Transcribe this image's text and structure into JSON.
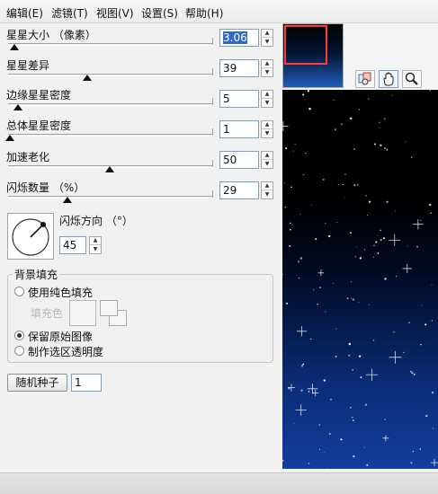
{
  "menu": [
    "编辑(E)",
    "滤镜(T)",
    "视图(V)",
    "设置(S)",
    "帮助(H)"
  ],
  "sliders": [
    {
      "label": "星星大小 （像素）",
      "value": "3.06",
      "selected": true,
      "level": 0.03
    },
    {
      "label": "星星差异",
      "value": "39",
      "selected": false,
      "level": 0.39
    },
    {
      "label": "边缘星星密度",
      "value": "5",
      "selected": false,
      "level": 0.05
    },
    {
      "label": "总体星星密度",
      "value": "1",
      "selected": false,
      "level": 0.01
    },
    {
      "label": "加速老化",
      "value": "50",
      "selected": false,
      "level": 0.5
    },
    {
      "label": "闪烁数量 （%）",
      "value": "29",
      "selected": false,
      "level": 0.29
    }
  ],
  "direction": {
    "label": "闪烁方向 （°）",
    "value": "45"
  },
  "background": {
    "title": "背景填充",
    "option_solid": "使用纯色填充",
    "fill_color_label": "填充色",
    "option_keep": "保留原始图像",
    "option_transparency": "制作选区透明度",
    "selected": "keep"
  },
  "seed": {
    "button": "随机种子",
    "value": "1"
  },
  "tools": [
    "view-icon",
    "hand-icon",
    "zoom-icon"
  ],
  "colors": {
    "accent": "#316ac5",
    "thumb_frame": "#ff3a3a"
  }
}
